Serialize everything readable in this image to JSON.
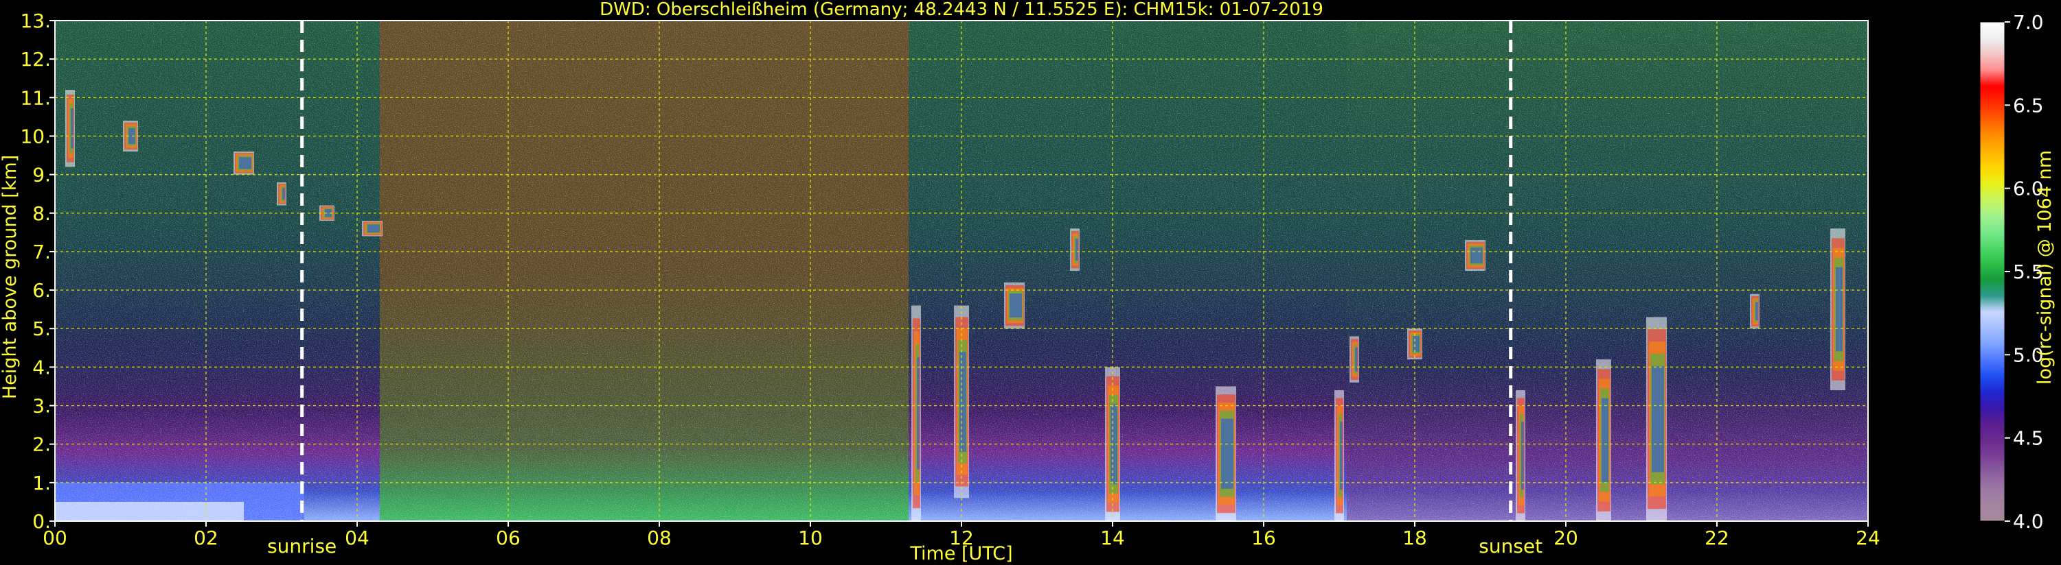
{
  "chart_data": {
    "type": "heatmap",
    "title": "DWD: Oberschleißheim (Germany; 48.2443 N / 11.5525 E):    CHM15k: 01-07-2019",
    "xlabel": "Time [UTC]",
    "ylabel": "Height above ground [km]",
    "xlim": [
      0,
      24
    ],
    "ylim": [
      0,
      13
    ],
    "x_ticks": [
      "00",
      "02",
      "04",
      "06",
      "08",
      "10",
      "12",
      "14",
      "16",
      "18",
      "20",
      "22",
      "24"
    ],
    "y_ticks": [
      "0.",
      "1.",
      "2.",
      "3.",
      "4.",
      "5.",
      "6.",
      "7.",
      "8.",
      "9.",
      "10.",
      "11.",
      "12.",
      "13."
    ],
    "grid": true,
    "grid_color": "#e8e800",
    "text_color": "#ffff33",
    "background": "#000000",
    "annotations": [
      {
        "label": "sunrise",
        "x": 3.27
      },
      {
        "label": "sunset",
        "x": 19.27
      }
    ],
    "colorbar": {
      "label": "log(rc-signal) @ 1064 nm",
      "range": [
        4.0,
        7.0
      ],
      "ticks": [
        "4.0",
        "4.5",
        "5.0",
        "5.5",
        "6.0",
        "6.5",
        "7.0"
      ],
      "colors": [
        "#a68a9c",
        "#a584a0",
        "#9b78a4",
        "#8c5ea0",
        "#7a3f96",
        "#6b2a8e",
        "#5a1f90",
        "#3a17a8",
        "#1f27d0",
        "#1f4ff2",
        "#4f78ff",
        "#7fa3ff",
        "#a6c0ff",
        "#c8d7ff",
        "#2e9a8c",
        "#169a3a",
        "#2fbf4a",
        "#4fd86a",
        "#79e98a",
        "#a3f28c",
        "#c8f55a",
        "#e8f018",
        "#ffd400",
        "#ffb000",
        "#ff8c00",
        "#ff5a00",
        "#ff2a00",
        "#ff0000",
        "#ff8c8c",
        "#f2c6c6",
        "#f0f0f0",
        "#ffffff"
      ]
    },
    "series": [
      {
        "values": [
          {
            "x": 0.2,
            "y0": 9.2,
            "y1": 11.2
          },
          {
            "x": 1.0,
            "y0": 9.6,
            "y1": 10.4
          },
          {
            "x": 2.5,
            "y0": 9.0,
            "y1": 9.6
          },
          {
            "x": 3.0,
            "y0": 8.2,
            "y1": 8.8
          },
          {
            "x": 3.6,
            "y0": 7.8,
            "y1": 8.2
          },
          {
            "x": 4.2,
            "y0": 7.4,
            "y1": 7.8
          }
        ]
      },
      {
        "values": [
          {
            "x": 11.4,
            "y0": 0.0,
            "y1": 5.6
          },
          {
            "x": 12.0,
            "y0": 0.6,
            "y1": 5.6
          },
          {
            "x": 12.7,
            "y0": 5.0,
            "y1": 6.2
          },
          {
            "x": 13.5,
            "y0": 6.5,
            "y1": 7.6
          },
          {
            "x": 14.0,
            "y0": 0.0,
            "y1": 4.0
          },
          {
            "x": 15.5,
            "y0": 0.0,
            "y1": 3.5
          },
          {
            "x": 17.0,
            "y0": 0.0,
            "y1": 3.4
          }
        ]
      },
      {
        "values": [
          {
            "x": 17.2,
            "y0": 3.6,
            "y1": 4.8
          },
          {
            "x": 18.0,
            "y0": 4.2,
            "y1": 5.0
          },
          {
            "x": 18.8,
            "y0": 6.5,
            "y1": 7.3
          }
        ]
      },
      {
        "values": [
          {
            "x": 19.4,
            "y0": 0.0,
            "y1": 3.4
          },
          {
            "x": 20.5,
            "y0": 0.0,
            "y1": 4.2
          },
          {
            "x": 21.2,
            "y0": 0.0,
            "y1": 5.3
          },
          {
            "x": 22.5,
            "y0": 5.0,
            "y1": 5.9
          },
          {
            "x": 23.6,
            "y0": 3.4,
            "y1": 7.6
          }
        ]
      }
    ]
  }
}
